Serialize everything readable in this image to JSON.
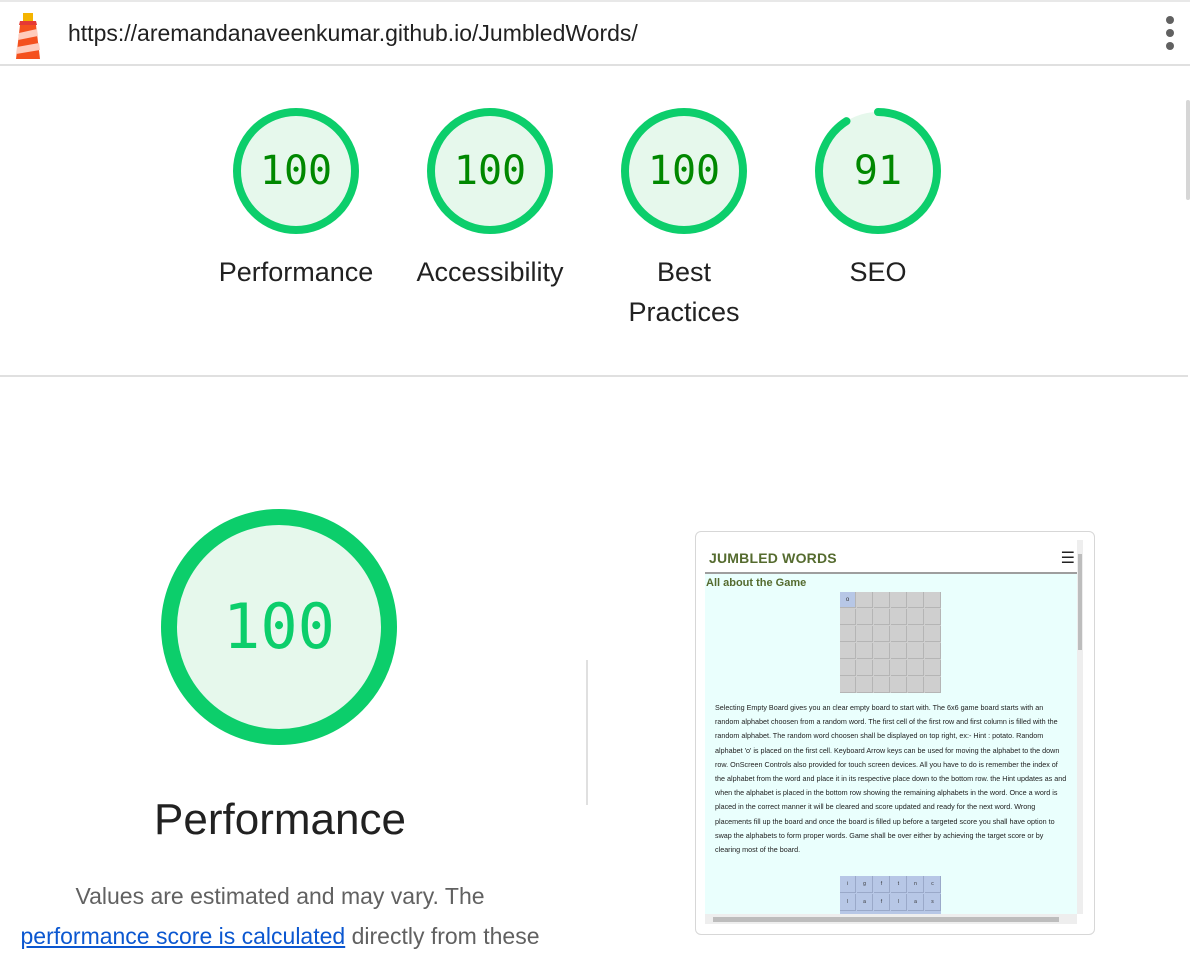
{
  "topbar": {
    "url": "https://aremandanaveenkumar.github.io/JumbledWords/",
    "logo_icon": "lighthouse-icon",
    "menu_icon": "more-vert-icon"
  },
  "scores": [
    {
      "value": "100",
      "score": 100,
      "label": "Performance"
    },
    {
      "value": "100",
      "score": 100,
      "label": "Accessibility"
    },
    {
      "value": "100",
      "score": 100,
      "label_line1": "Best",
      "label_line2": "Practices"
    },
    {
      "value": "91",
      "score": 91,
      "label": "SEO"
    }
  ],
  "colors": {
    "pass_ring": "#0cce6b",
    "pass_fill": "#e6f8ec",
    "pass_text": "#008800",
    "link": "#0b57d0"
  },
  "performance": {
    "score": "100",
    "score_value": 100,
    "title": "Performance",
    "desc_before": "Values are estimated and may vary. The",
    "link_text": "performance score is calculated",
    "desc_after": " directly from these"
  },
  "thumbnail": {
    "title": "JUMBLED WORDS",
    "menu_icon": "hamburger-menu-icon",
    "subtitle": "All about the Game",
    "first_cell": "o",
    "paragraph": "Selecting Empty Board gives you an clear empty board to start with. The 6x6 game board starts with an random alphabet choosen from a random word. The first cell of the first row and first column is filled with the random alphabet. The random word choosen shall be displayed on top right, ex:- Hint : potato. Random alphabet 'o' is placed on the first cell. Keyboard Arrow keys can be used for moving the alphabet to the down row. OnScreen Controls also provided for touch screen devices. All you have to do is remember the index of the alphabet from the word and place it in its respective place down to the bottom row. the Hint updates as and when the alphabet is placed in the bottom row showing the remaining alphabets in the word. Once a word is placed in the correct manner it will be cleared and score updated and ready for the next word. Wrong placements fill up the board and once the board is filled up before a targeted score you shall have option to swap the alphabets to form proper words. Game shall be over either by achieving the target score or by clearing most of the board.",
    "bottom_grid_row1": [
      "i",
      "g",
      "f",
      "t",
      "n",
      "c"
    ],
    "bottom_grid_row2": [
      "l",
      "a",
      "f",
      "l",
      "a",
      "s"
    ]
  }
}
